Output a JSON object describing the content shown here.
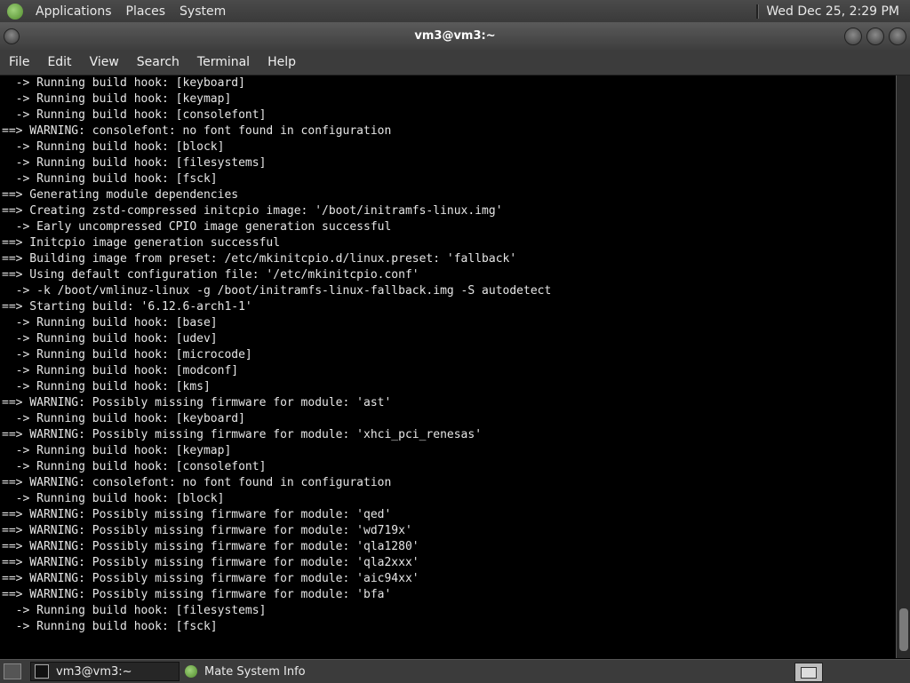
{
  "top_panel": {
    "menus": [
      "Applications",
      "Places",
      "System"
    ],
    "clock": "Wed Dec 25,  2:29 PM"
  },
  "window": {
    "title": "vm3@vm3:~"
  },
  "menubar": [
    "File",
    "Edit",
    "View",
    "Search",
    "Terminal",
    "Help"
  ],
  "terminal": {
    "lines": [
      "  -> Running build hook: [keyboard]",
      "  -> Running build hook: [keymap]",
      "  -> Running build hook: [consolefont]",
      "==> WARNING: consolefont: no font found in configuration",
      "  -> Running build hook: [block]",
      "  -> Running build hook: [filesystems]",
      "  -> Running build hook: [fsck]",
      "==> Generating module dependencies",
      "==> Creating zstd-compressed initcpio image: '/boot/initramfs-linux.img'",
      "  -> Early uncompressed CPIO image generation successful",
      "==> Initcpio image generation successful",
      "==> Building image from preset: /etc/mkinitcpio.d/linux.preset: 'fallback'",
      "==> Using default configuration file: '/etc/mkinitcpio.conf'",
      "  -> -k /boot/vmlinuz-linux -g /boot/initramfs-linux-fallback.img -S autodetect",
      "==> Starting build: '6.12.6-arch1-1'",
      "  -> Running build hook: [base]",
      "  -> Running build hook: [udev]",
      "  -> Running build hook: [microcode]",
      "  -> Running build hook: [modconf]",
      "  -> Running build hook: [kms]",
      "==> WARNING: Possibly missing firmware for module: 'ast'",
      "  -> Running build hook: [keyboard]",
      "==> WARNING: Possibly missing firmware for module: 'xhci_pci_renesas'",
      "  -> Running build hook: [keymap]",
      "  -> Running build hook: [consolefont]",
      "==> WARNING: consolefont: no font found in configuration",
      "  -> Running build hook: [block]",
      "==> WARNING: Possibly missing firmware for module: 'qed'",
      "==> WARNING: Possibly missing firmware for module: 'wd719x'",
      "==> WARNING: Possibly missing firmware for module: 'qla1280'",
      "==> WARNING: Possibly missing firmware for module: 'qla2xxx'",
      "==> WARNING: Possibly missing firmware for module: 'aic94xx'",
      "==> WARNING: Possibly missing firmware for module: 'bfa'",
      "  -> Running build hook: [filesystems]",
      "  -> Running build hook: [fsck]"
    ]
  },
  "taskbar": {
    "tasks": [
      {
        "label": "vm3@vm3:~",
        "icon": "terminal-icon",
        "active": true
      },
      {
        "label": "Mate System Info",
        "icon": "mate-logo-icon",
        "active": false
      }
    ]
  },
  "colors": {
    "panel": "#3a3a3a",
    "terminal_bg": "#000000",
    "terminal_fg": "#e6e6e6",
    "mate_green": "#6aa33a"
  }
}
